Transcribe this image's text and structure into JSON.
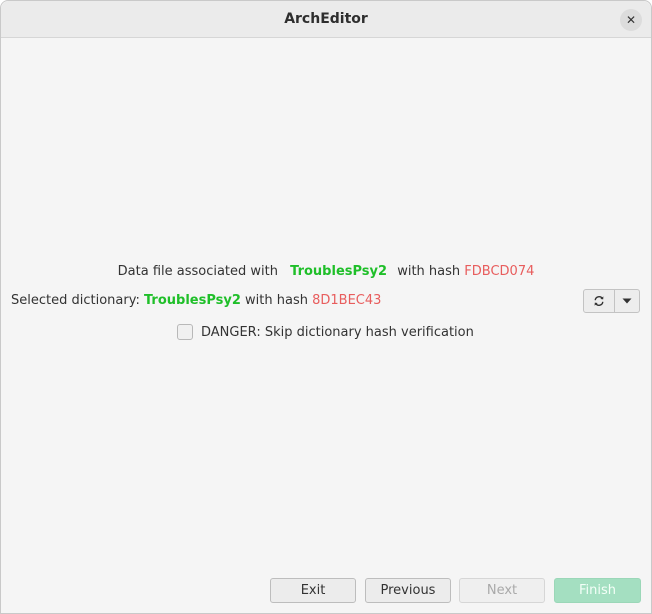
{
  "window": {
    "title": "ArchEditor",
    "close_icon": "close-icon",
    "close_glyph": "✕"
  },
  "data_file": {
    "prefix": "Data file associated with",
    "name": "TroublesPsy2",
    "hash_label": "with hash",
    "hash": "FDBCD074"
  },
  "dictionary": {
    "prefix": "Selected dictionary:",
    "name": "TroublesPsy2",
    "hash_label": "with hash",
    "hash": "8D1BEC43",
    "refresh_icon": "refresh-icon",
    "dropdown_icon": "chevron-down-icon"
  },
  "danger": {
    "label": "DANGER: Skip dictionary hash verification",
    "checked": false
  },
  "buttons": {
    "exit": "Exit",
    "previous": "Previous",
    "next": "Next",
    "finish": "Finish"
  },
  "colors": {
    "accent_green": "#1fbf29",
    "hash_red": "#e85d5d",
    "finish_bg": "#a4dfc1"
  }
}
